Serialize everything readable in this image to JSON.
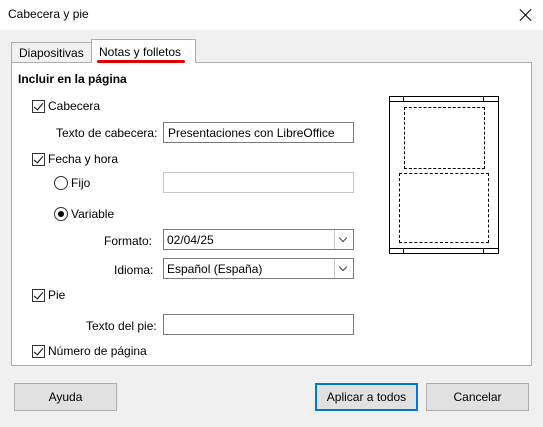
{
  "window": {
    "title": "Cabecera y pie"
  },
  "tabs": [
    {
      "label": "Diapositivas",
      "active": false
    },
    {
      "label": "Notas y folletos",
      "active": true
    }
  ],
  "section": {
    "heading": "Incluir en la página"
  },
  "header": {
    "checkbox_label": "Cabecera",
    "checked": true,
    "text_label": "Texto de cabecera:",
    "text_value": "Presentaciones con LibreOffice"
  },
  "datetime": {
    "checkbox_label": "Fecha y hora",
    "checked": true,
    "fixed_label": "Fijo",
    "fixed_value": "",
    "variable_label": "Variable",
    "selected": "Variable",
    "format_label": "Formato:",
    "format_value": "02/04/25",
    "language_label": "Idioma:",
    "language_value": "Español (España)"
  },
  "footer": {
    "checkbox_label": "Pie",
    "checked": true,
    "text_label": "Texto del pie:",
    "text_value": ""
  },
  "page_number": {
    "checkbox_label": "Número de página",
    "checked": true
  },
  "buttons": {
    "help": "Ayuda",
    "apply_all": "Aplicar a todos",
    "cancel": "Cancelar"
  },
  "colors": {
    "annotation_underline": "#e00000",
    "default_button_border": "#0078d7"
  }
}
